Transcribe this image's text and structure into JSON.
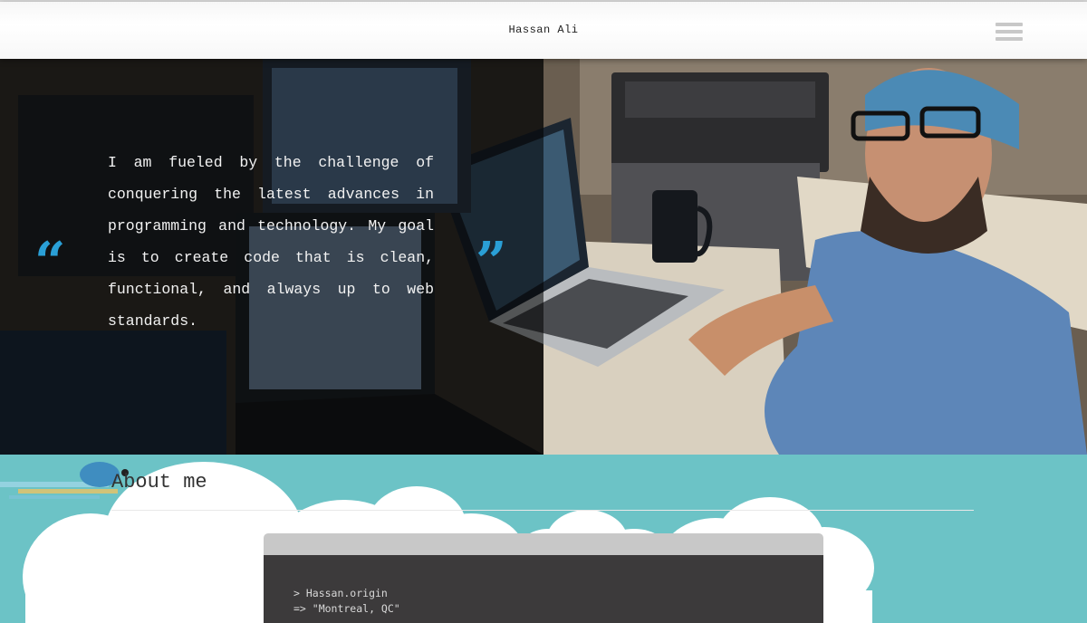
{
  "header": {
    "site_title": "Hassan Ali",
    "menu_icon": "hamburger-menu-icon"
  },
  "hero": {
    "quote": "I am fueled by the challenge of conquering the latest advances in programming and technology. My goal is to create code that is clean, functional, and always up to web standards.",
    "open_quote": "“",
    "close_quote": "”",
    "accent_color": "#2a9fd6"
  },
  "about": {
    "title": "About me",
    "background_color": "#6cc3c6",
    "terminal": {
      "lines": [
        "> Hassan.origin",
        "=> \"Montreal, QC\""
      ]
    }
  }
}
